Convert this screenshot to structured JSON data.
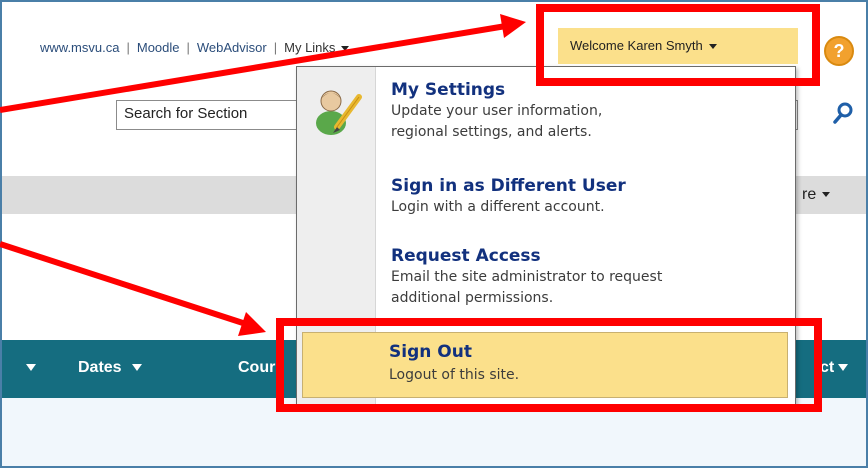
{
  "top_links": {
    "site": "www.msvu.ca",
    "moodle": "Moodle",
    "webadvisor": "WebAdvisor",
    "my_links": "My Links",
    "separator": "|"
  },
  "welcome": {
    "label": "Welcome Karen Smyth"
  },
  "help": {
    "label": "?"
  },
  "search": {
    "value": "Search for Section"
  },
  "graybar": {
    "right_text": "re"
  },
  "menu": {
    "items": [
      {
        "title": "My Settings",
        "desc1": "Update your user information,",
        "desc2": "regional settings, and alerts."
      },
      {
        "title": "Sign in as Different User",
        "desc1": "Login with a different account."
      },
      {
        "title": "Request Access",
        "desc1": "Email the site administrator to request",
        "desc2": "additional permissions."
      }
    ],
    "signout": {
      "title": "Sign Out",
      "desc": "Logout of this site."
    }
  },
  "tealbar": {
    "columns": [
      "Dates",
      "Cours",
      "ct"
    ]
  },
  "colors": {
    "highlight": "#fbe08b",
    "teal": "#156d80",
    "annotation_red": "#ff0000",
    "link_blue": "#12317e"
  }
}
